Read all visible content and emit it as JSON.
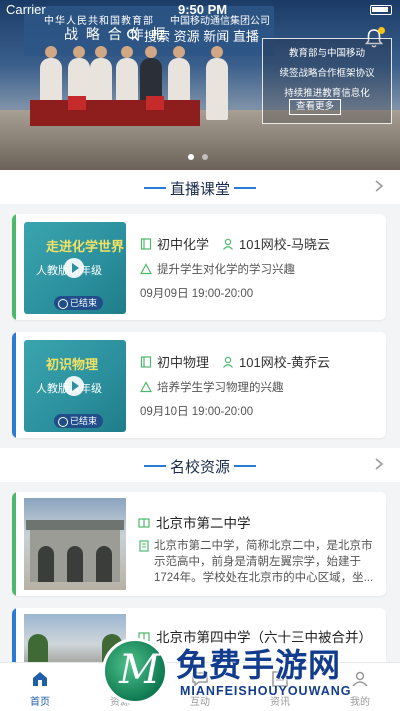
{
  "status_bar": {
    "carrier": "Carrier",
    "time": "9:50 PM"
  },
  "banner": {
    "heading_left": "中华人民共和国教育部",
    "heading_right": "中国移动通信集团公司",
    "big_text": "战 略 合 作 框",
    "search_text": "搜索 资源 新闻 直播",
    "caption_lines": [
      "教育部与中国移动",
      "续签战略合作框架协议",
      "持续推进教育信息化"
    ],
    "more_button": "查看更多",
    "slide_count": 2,
    "active_slide": 0
  },
  "live_section": {
    "title": "直播课堂",
    "courses": [
      {
        "thumb_title": "走进化学世界",
        "thumb_sub": "人教版九年级",
        "status": "已结束",
        "subject": "初中化学",
        "teacher": "101网校-马晓云",
        "description": "提升学生对化学的学习兴趣",
        "time": "09月09日 19:00-20:00",
        "accent": "#4cb86a"
      },
      {
        "thumb_title": "初识物理",
        "thumb_sub": "人教版八年级",
        "status": "已结束",
        "subject": "初中物理",
        "teacher": "101网校-黄乔云",
        "description": "培养学生学习物理的兴趣",
        "time": "09月10日 19:00-20:00",
        "accent": "#2a7bd4"
      }
    ]
  },
  "school_section": {
    "title": "名校资源",
    "schools": [
      {
        "name": "北京市第二中学",
        "description": "北京市第二中学，简称北京二中，是北京市示范高中，前身是清朝左翼宗学，始建于1724年。学校处在北京市的中心区域，坐...",
        "accent": "#4cb86a"
      },
      {
        "name": "北京市第四中学（六十三中被合并）",
        "description": "",
        "accent": "#2a7bd4"
      }
    ]
  },
  "tabbar": {
    "tabs": [
      {
        "label": "首页",
        "icon": "home-icon",
        "active": true
      },
      {
        "label": "资源",
        "icon": "resource-icon",
        "active": false
      },
      {
        "label": "互动",
        "icon": "interact-icon",
        "active": false
      },
      {
        "label": "资讯",
        "icon": "news-icon",
        "active": false
      },
      {
        "label": "我的",
        "icon": "profile-icon",
        "active": false
      }
    ]
  },
  "watermark": {
    "big": "免费手游网",
    "small": "MIANFEISHOUYOUWANG",
    "logo_letter": "M"
  },
  "colors": {
    "accent": "#2a7bd4",
    "green": "#4cb86a",
    "active_tab": "#1f5ea8"
  }
}
